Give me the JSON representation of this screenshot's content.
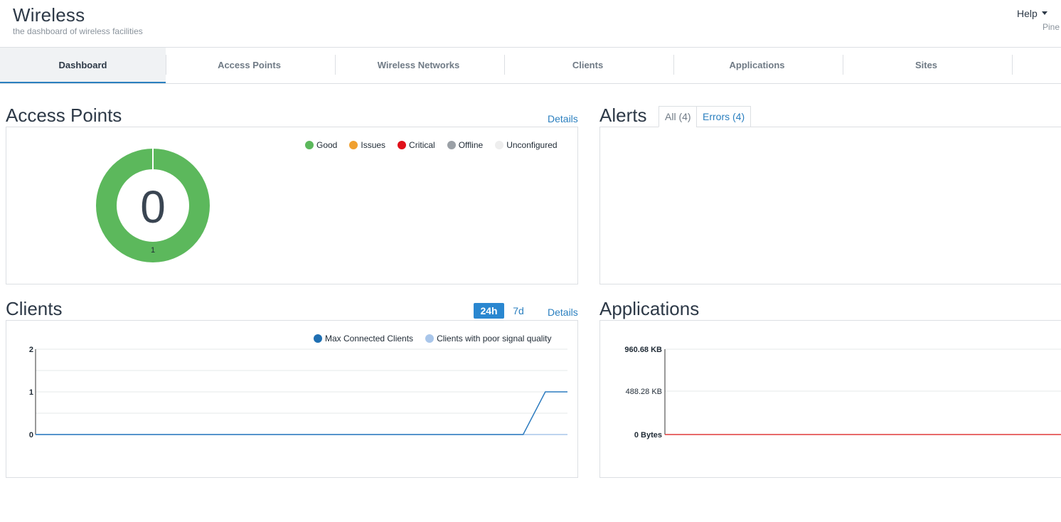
{
  "header": {
    "title": "Wireless",
    "subtitle": "the dashboard of wireless facilities",
    "help_label": "Help",
    "user_name": "Pine"
  },
  "tabs": [
    {
      "label": "Dashboard",
      "active": true
    },
    {
      "label": "Access Points",
      "active": false
    },
    {
      "label": "Wireless Networks",
      "active": false
    },
    {
      "label": "Clients",
      "active": false
    },
    {
      "label": "Applications",
      "active": false
    },
    {
      "label": "Sites",
      "active": false
    }
  ],
  "access_points": {
    "title": "Access Points",
    "details_label": "Details",
    "center_value": "0",
    "segment_label": "1",
    "legend": [
      {
        "label": "Good",
        "color": "#5cb85c"
      },
      {
        "label": "Issues",
        "color": "#f0a030"
      },
      {
        "label": "Critical",
        "color": "#e0101a"
      },
      {
        "label": "Offline",
        "color": "#9aa0a6"
      },
      {
        "label": "Unconfigured",
        "color": "#eeeeee"
      }
    ]
  },
  "alerts": {
    "title": "Alerts",
    "tab_all": "All (4)",
    "tab_errors": "Errors (4)"
  },
  "clients": {
    "title": "Clients",
    "range_24h": "24h",
    "range_7d": "7d",
    "details_label": "Details",
    "legend": [
      {
        "label": "Max Connected Clients",
        "color": "#1f6fb2"
      },
      {
        "label": "Clients with poor signal quality",
        "color": "#a9c6ea"
      }
    ]
  },
  "applications": {
    "title": "Applications"
  },
  "chart_data": [
    {
      "type": "pie",
      "title": "Access Points",
      "categories": [
        "Good",
        "Issues",
        "Critical",
        "Offline",
        "Unconfigured"
      ],
      "values": [
        1,
        0,
        0,
        0,
        0
      ],
      "center_label": "0"
    },
    {
      "type": "line",
      "title": "Clients",
      "x": [
        0,
        1,
        2,
        3,
        4,
        5,
        6,
        7,
        8,
        9,
        10,
        11,
        12,
        13,
        14,
        15,
        16,
        17,
        18,
        19,
        20,
        21,
        22,
        23,
        24
      ],
      "series": [
        {
          "name": "Max Connected Clients",
          "values": [
            0,
            0,
            0,
            0,
            0,
            0,
            0,
            0,
            0,
            0,
            0,
            0,
            0,
            0,
            0,
            0,
            0,
            0,
            0,
            0,
            0,
            0,
            0,
            1,
            1
          ]
        },
        {
          "name": "Clients with poor signal quality",
          "values": [
            0,
            0,
            0,
            0,
            0,
            0,
            0,
            0,
            0,
            0,
            0,
            0,
            0,
            0,
            0,
            0,
            0,
            0,
            0,
            0,
            0,
            0,
            0,
            0,
            0
          ]
        }
      ],
      "ytick_labels": [
        "0",
        "1",
        "2"
      ],
      "ylim": [
        0,
        2
      ],
      "grid": true
    },
    {
      "type": "line",
      "title": "Applications",
      "series": [
        {
          "values": [
            0,
            0
          ]
        }
      ],
      "ytick_labels": [
        "0 Bytes",
        "488.28 KB",
        "960.68 KB"
      ],
      "yticks": [
        0,
        488.28,
        960.68
      ],
      "ylim": [
        0,
        960.68
      ],
      "grid": true,
      "line_color": "#e03a3a"
    }
  ]
}
